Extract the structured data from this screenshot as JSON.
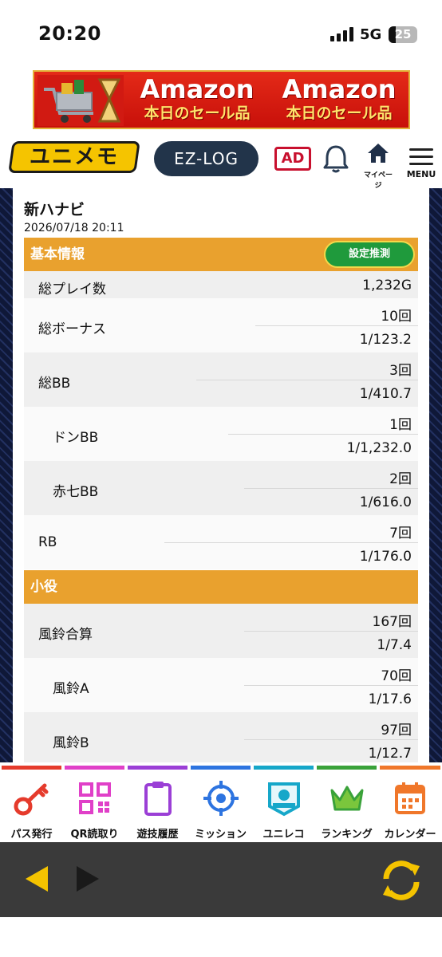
{
  "status_bar": {
    "time": "20:20",
    "network": "5G",
    "battery": "25"
  },
  "banner": {
    "line1a": "Amazon",
    "line1b": "Amazon",
    "line2a": "本日のセール品",
    "line2b": "本日のセール品"
  },
  "header": {
    "logo": "ユニメモ",
    "ezlog": "EZ-LOG",
    "ad": "AD",
    "mypage_label": "マイページ",
    "menu_label": "MENU"
  },
  "machine": {
    "name": "新ハナビ",
    "datetime": "2026/07/18 20:11"
  },
  "sections": {
    "basic": {
      "title": "基本情報",
      "button": "設定推測"
    },
    "koyaku": {
      "title": "小役"
    }
  },
  "basic_rows": [
    {
      "label": "総プレイ数",
      "value": "1,232G"
    },
    {
      "label": "総ボーナス",
      "count": "10回",
      "prob": "1/123.2"
    },
    {
      "label": "総BB",
      "count": "3回",
      "prob": "1/410.7"
    },
    {
      "label": "ドンBB",
      "count": "1回",
      "prob": "1/1,232.0"
    },
    {
      "label": "赤七BB",
      "count": "2回",
      "prob": "1/616.0"
    },
    {
      "label": "RB",
      "count": "7回",
      "prob": "1/176.0"
    }
  ],
  "koyaku_rows": [
    {
      "label": "風鈴合算",
      "count": "167回",
      "prob": "1/7.4"
    },
    {
      "label": "風鈴A",
      "count": "70回",
      "prob": "1/17.6"
    },
    {
      "label": "風鈴B",
      "count": "97回",
      "prob": "1/12.7"
    }
  ],
  "bottom_nav": [
    {
      "label": "パス発行",
      "icon": "key-icon",
      "color": "#e53b2c"
    },
    {
      "label": "QR読取り",
      "icon": "qr-icon",
      "color": "#e040c8"
    },
    {
      "label": "遊技履歴",
      "icon": "clipboard-icon",
      "color": "#9b3fd6"
    },
    {
      "label": "ミッション",
      "icon": "target-icon",
      "color": "#2d74e0"
    },
    {
      "label": "ユニレコ",
      "icon": "unireco-icon",
      "color": "#16a7c9"
    },
    {
      "label": "ランキング",
      "icon": "crown-icon",
      "color": "#3aa23a"
    },
    {
      "label": "カレンダー",
      "icon": "calendar-icon",
      "color": "#f0772a"
    }
  ],
  "colors": {
    "section": "#e9a12e",
    "accent_yellow": "#f5c400",
    "browser_bar": "#3a3a3a"
  }
}
